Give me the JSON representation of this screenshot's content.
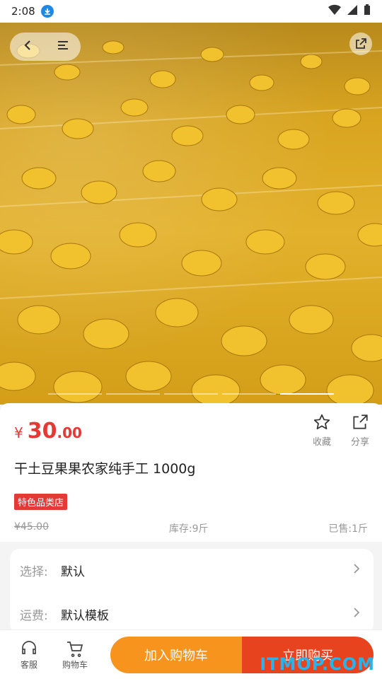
{
  "status_bar": {
    "time": "2:08"
  },
  "product": {
    "currency": "¥",
    "price_int": "30",
    "price_dec": ".00",
    "title": "干土豆果果农家纯手工 1000g",
    "badge": "特色品类店",
    "original_price": "¥45.00",
    "stock": "库存:9斤",
    "sold": "已售:1斤"
  },
  "actions": {
    "favorite_label": "收藏",
    "share_label": "分享"
  },
  "options": {
    "choose_label": "选择:",
    "choose_value": "默认",
    "shipping_label": "运费:",
    "shipping_value": "默认模板"
  },
  "bottom_bar": {
    "service_label": "客服",
    "cart_label": "购物车",
    "add_to_cart": "加入购物车",
    "buy_now": "立即购买"
  },
  "carousel": {
    "total": 5,
    "active_index": 4
  },
  "watermark": "ITMOP.COM",
  "colors": {
    "price": "#e53935",
    "cart_button": "#f7941d",
    "buy_button": "#e8431f",
    "badge": "#e53935"
  }
}
